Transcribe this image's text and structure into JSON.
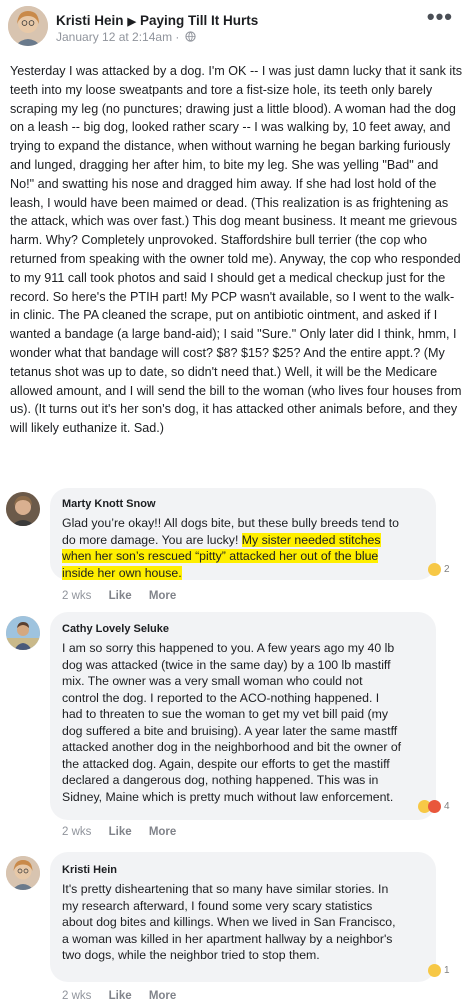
{
  "post": {
    "author": "Kristi Hein",
    "arrow": "▶",
    "group": "Paying Till It Hurts",
    "timestamp": "January 12 at 2:14am",
    "separator": "·",
    "globe_icon": "globe-icon",
    "more_icon": "more-options-icon",
    "body": "Yesterday I was attacked by a dog. I'm OK -- I was just damn lucky that it sank its teeth into my loose sweatpants and tore a fist-size hole, its teeth only barely scraping my leg (no punctures; drawing just a little blood). A woman had the dog on a leash -- big dog, looked rather scary -- I was walking by, 10 feet away, and trying to expand the distance, when without warning he began barking furiously and lunged, dragging her after him, to bite my leg. She was yelling \"Bad\" and No!\" and swatting his nose and dragged him away. If she had lost hold of the leash, I would have been maimed or dead. (This realization is as frightening as the attack, which was over fast.) This dog meant business. It meant me grievous harm. Why? Completely unprovoked. Staffordshire bull terrier (the cop who returned from speaking with the owner told me). Anyway, the cop who responded to my 911 call took photos and said I should get a medical checkup just for the record. So here's the PTIH part! My PCP wasn't available, so I went to the walk-in clinic. The PA cleaned the scrape, put on antibiotic ointment, and asked if I wanted a bandage (a large band-aid); I said \"Sure.\" Only later did I think, hmm, I wonder what that bandage will cost? $8? $15? $25? And the entire appt.? (My tetanus shot was up to date, so didn't need that.) Well, it will be the Medicare allowed amount, and I will send the bill to the woman (who lives four houses from us). (It turns out it's her son's dog, it has attacked other animals before, and they will likely euthanize it. Sad.)"
  },
  "comments": [
    {
      "name": "Marty Knott Snow",
      "text_plain": "Glad you’re okay!! All dogs bite, but these bully breeds tend to do more damage. You are lucky! ",
      "text_highlight": "My sister needed stitches when her son’s rescued “pitty” attacked her out of the blue inside her own house.",
      "reaction_count": "2",
      "age": "2 wks",
      "like": "Like",
      "more": "More"
    },
    {
      "name": "Cathy Lovely Seluke",
      "text": "I am so sorry this happened to you. A few years ago my 40 lb dog was attacked (twice in the same day) by a 100 lb mastiff mix. The owner was a very small woman who could not control the dog. I reported to the ACO-nothing happened. I had to threaten to sue the woman to get my vet bill paid (my dog suffered a bite and bruising). A year later the same mastff attacked another dog in the neighborhood and bit the owner of the attacked dog. Again, despite our efforts to get the mastiff declared a dangerous dog, nothing happened. This was in Sidney, Maine which is pretty much without law enforcement.",
      "reaction_count": "4",
      "age": "2 wks",
      "like": "Like",
      "more": "More"
    },
    {
      "name": "Kristi Hein",
      "text": "It's pretty disheartening that so many have similar stories. In my research afterward, I found some very scary statistics about dog bites and killings. When we lived in San Francisco, a woman was killed in her apartment hallway by a neighbor's two dogs, while the neighbor tried to stop them.",
      "reaction_count": "1",
      "age": "2 wks",
      "like": "Like",
      "more": "More"
    }
  ],
  "colors": {
    "bubble": "#f2f3f5",
    "highlight": "#ffef00",
    "meta_gray": "#90949c"
  }
}
